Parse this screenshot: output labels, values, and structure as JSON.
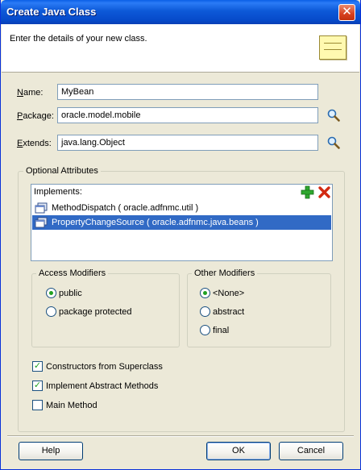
{
  "window": {
    "title": "Create Java Class",
    "close_glyph": "✕",
    "description": "Enter the details of your new class."
  },
  "form": {
    "name": {
      "label": "Name:",
      "mnemonic": "N",
      "rest": "ame:",
      "value": "MyBean"
    },
    "package": {
      "label": "Package:",
      "mnemonic": "P",
      "rest": "ackage:",
      "value": "oracle.model.mobile"
    },
    "extends": {
      "label": "Extends:",
      "mnemonic": "E",
      "rest": "xtends:",
      "value": "java.lang.Object"
    }
  },
  "optional": {
    "title": "Optional Attributes",
    "implements_label": "Implements:",
    "implements": [
      {
        "text": "MethodDispatch ( oracle.adfnmc.util )",
        "selected": false
      },
      {
        "text": "PropertyChangeSource ( oracle.adfnmc.java.beans )",
        "selected": true
      }
    ],
    "access": {
      "title": "Access Modifiers",
      "options": [
        {
          "label": "public",
          "checked": true
        },
        {
          "label": "package protected",
          "checked": false
        }
      ]
    },
    "other": {
      "title": "Other Modifiers",
      "options": [
        {
          "label": "<None>",
          "checked": true
        },
        {
          "label": "abstract",
          "checked": false
        },
        {
          "label": "final",
          "checked": false
        }
      ]
    },
    "checkboxes": [
      {
        "label": "Constructors from Superclass",
        "checked": true
      },
      {
        "label": "Implement Abstract Methods",
        "checked": true
      },
      {
        "label": "Main Method",
        "checked": false
      }
    ]
  },
  "buttons": {
    "help": "Help",
    "ok": "OK",
    "cancel": "Cancel"
  },
  "colors": {
    "title_bar": "#0a5fe6",
    "selection": "#316ac5",
    "dialog_bg": "#ece9d8",
    "add_icon": "#2ea82e",
    "remove_icon": "#d22a12"
  },
  "icons": [
    "close-icon",
    "note-icon",
    "search-icon",
    "add-icon",
    "remove-icon",
    "interface-icon"
  ]
}
